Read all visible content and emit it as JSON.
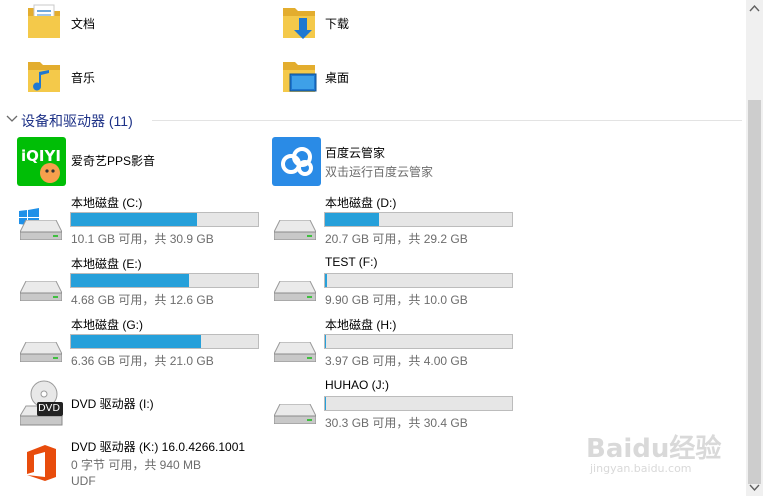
{
  "folders": [
    {
      "label": "文档",
      "icon": "documents-folder-icon"
    },
    {
      "label": "下载",
      "icon": "downloads-folder-icon"
    },
    {
      "label": "音乐",
      "icon": "music-folder-icon"
    },
    {
      "label": "桌面",
      "icon": "desktop-folder-icon"
    }
  ],
  "section": {
    "title": "设备和驱动器 (11)"
  },
  "apps": [
    {
      "name": "爱奇艺PPS影音",
      "sub": "",
      "icon": "iqiyi-icon"
    },
    {
      "name": "百度云管家",
      "sub": "双击运行百度云管家",
      "icon": "baidu-cloud-icon"
    }
  ],
  "drives": [
    {
      "name": "本地磁盘 (C:)",
      "free": "10.1 GB 可用，共 30.9 GB",
      "used_fraction": 0.673
    },
    {
      "name": "本地磁盘 (D:)",
      "free": "20.7 GB 可用，共 29.2 GB",
      "used_fraction": 0.291
    },
    {
      "name": "本地磁盘 (E:)",
      "free": "4.68 GB 可用，共 12.6 GB",
      "used_fraction": 0.629
    },
    {
      "name": "TEST (F:)",
      "free": "9.90 GB 可用，共 10.0 GB",
      "used_fraction": 0.01
    },
    {
      "name": "本地磁盘 (G:)",
      "free": "6.36 GB 可用，共 21.0 GB",
      "used_fraction": 0.697
    },
    {
      "name": "本地磁盘 (H:)",
      "free": "3.97 GB 可用，共 4.00 GB",
      "used_fraction": 0.008
    },
    {
      "name": "HUHAO (J:)",
      "free": "30.3 GB 可用，共 30.4 GB",
      "used_fraction": 0.003
    }
  ],
  "dvd_i": {
    "name": "DVD 驱动器 (I:)",
    "badge": "DVD"
  },
  "dvd_k": {
    "name": "DVD 驱动器 (K:) 16.0.4266.1001",
    "free": "0 字节 可用，共 940 MB",
    "fs": "UDF"
  },
  "watermark": {
    "brand": "Baidu经验",
    "url": "jingyan.baidu.com"
  },
  "colors": {
    "accent": "#26a0da",
    "folder": "#f4c94a",
    "iqiyi": "#00be06",
    "office": "#e84c0c"
  }
}
